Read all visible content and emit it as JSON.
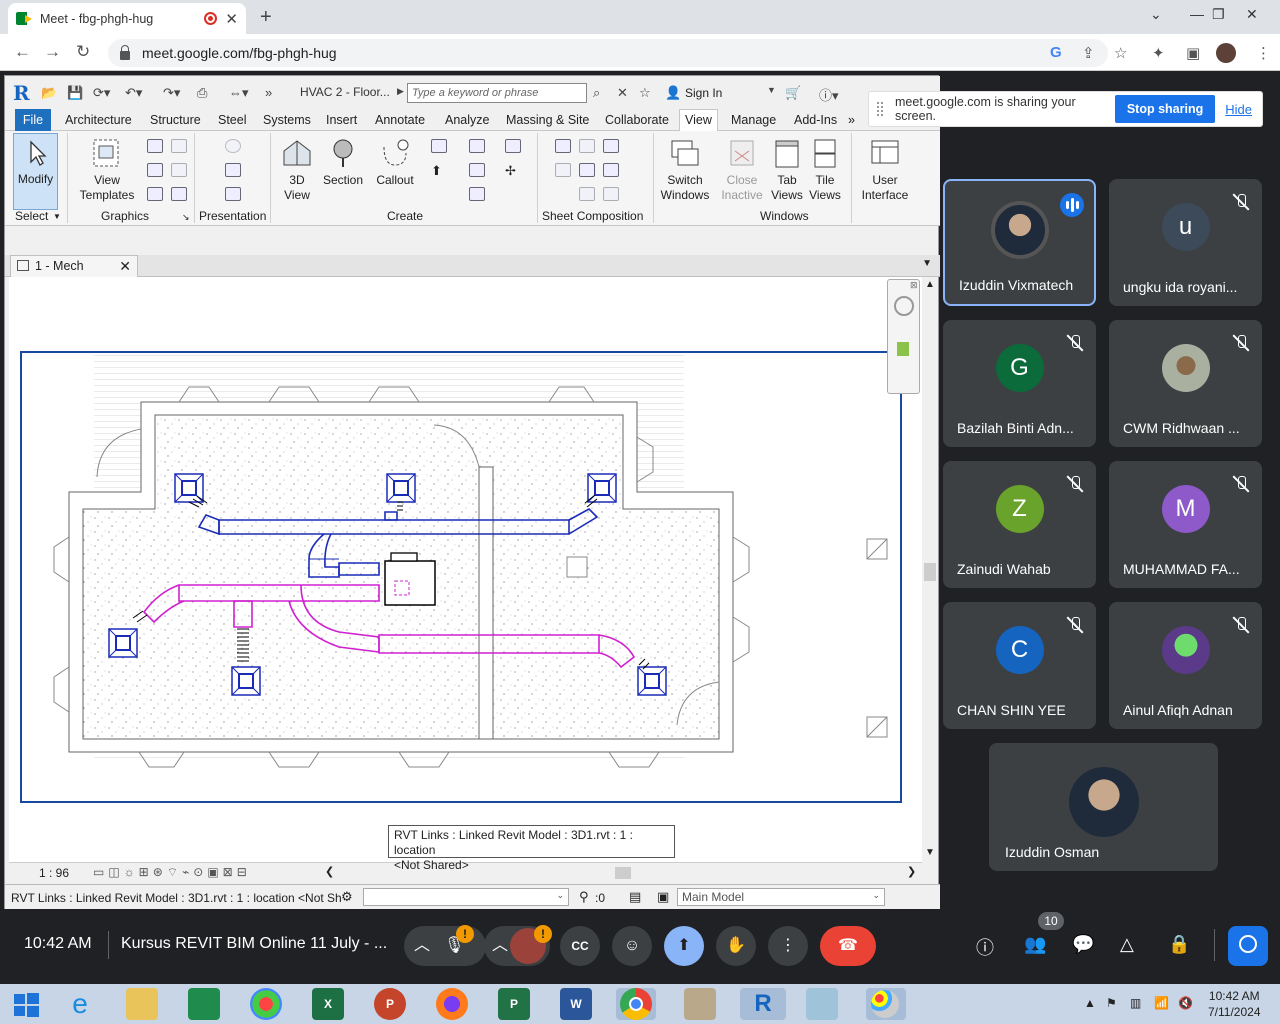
{
  "browser": {
    "tab_title": "Meet - fbg-phgh-hug",
    "url": "meet.google.com/fbg-phgh-hug"
  },
  "revit": {
    "doc_title": "HVAC 2 - Floor...",
    "search_placeholder": "Type a keyword or phrase",
    "sign_in": "Sign In",
    "menus": [
      "File",
      "Architecture",
      "Structure",
      "Steel",
      "Systems",
      "Insert",
      "Annotate",
      "Analyze",
      "Massing & Site",
      "Collaborate",
      "View",
      "Manage",
      "Add-Ins"
    ],
    "active_menu": "View",
    "ribbon": {
      "modify": "Modify",
      "select": "Select",
      "view_templates_1": "View",
      "view_templates_2": "Templates",
      "graphics": "Graphics",
      "presentation": "Presentation",
      "three_d_1": "3D",
      "three_d_2": "View",
      "section": "Section",
      "callout": "Callout",
      "create": "Create",
      "sheet_composition": "Sheet Composition",
      "switch_1": "Switch",
      "switch_2": "Windows",
      "close_1": "Close",
      "close_2": "Inactive",
      "tab_1": "Tab",
      "tab_2": "Views",
      "tile_1": "Tile",
      "tile_2": "Views",
      "windows": "Windows",
      "ui_1": "User",
      "ui_2": "Interface"
    },
    "view_tab": "1 - Mech",
    "scale": "1 : 96",
    "tooltip_line1": "RVT Links : Linked Revit Model : 3D1.rvt : 1 : location",
    "tooltip_line2": "<Not Shared>",
    "status_text": "RVT Links : Linked Revit Model : 3D1.rvt : 1 : location <Not Shared>",
    "status_zero": ":0",
    "main_model": "Main Model"
  },
  "share_banner": {
    "message": "meet.google.com is sharing your screen.",
    "stop": "Stop sharing",
    "hide": "Hide"
  },
  "participants": [
    {
      "name": "Izuddin Vixmatech",
      "initial": "",
      "color": "#3c4043",
      "speaking": true
    },
    {
      "name": "ungku ida royani...",
      "initial": "u",
      "color": "#3c4a5a",
      "speaking": false
    },
    {
      "name": "Bazilah Binti Adn...",
      "initial": "G",
      "color": "#0b6b3a",
      "speaking": false
    },
    {
      "name": "CWM Ridhwaan ...",
      "initial": "",
      "color": "#6b7060",
      "speaking": false
    },
    {
      "name": "Zainudi Wahab",
      "initial": "Z",
      "color": "#6aa32b",
      "speaking": false
    },
    {
      "name": "MUHAMMAD FA...",
      "initial": "M",
      "color": "#8e59c9",
      "speaking": false
    },
    {
      "name": "CHAN SHIN YEE",
      "initial": "C",
      "color": "#1565c0",
      "speaking": false
    },
    {
      "name": "Ainul Afiqh Adnan",
      "initial": "",
      "color": "#5b3a8a",
      "speaking": false
    },
    {
      "name": "Izuddin Osman",
      "initial": "",
      "color": "#3c4043",
      "speaking": false
    }
  ],
  "meet": {
    "time": "10:42 AM",
    "title": "Kursus REVIT BIM Online 11 July - ...",
    "participant_count": "10",
    "alert": "!"
  },
  "taskbar": {
    "clock_time": "10:42 AM",
    "clock_date": "7/11/2024"
  },
  "colors": {
    "supply_duct": "#1a2bb8",
    "return_duct": "#d020d0",
    "meet_blue": "#1a73e8",
    "revit_file": "#1f6fbf"
  }
}
